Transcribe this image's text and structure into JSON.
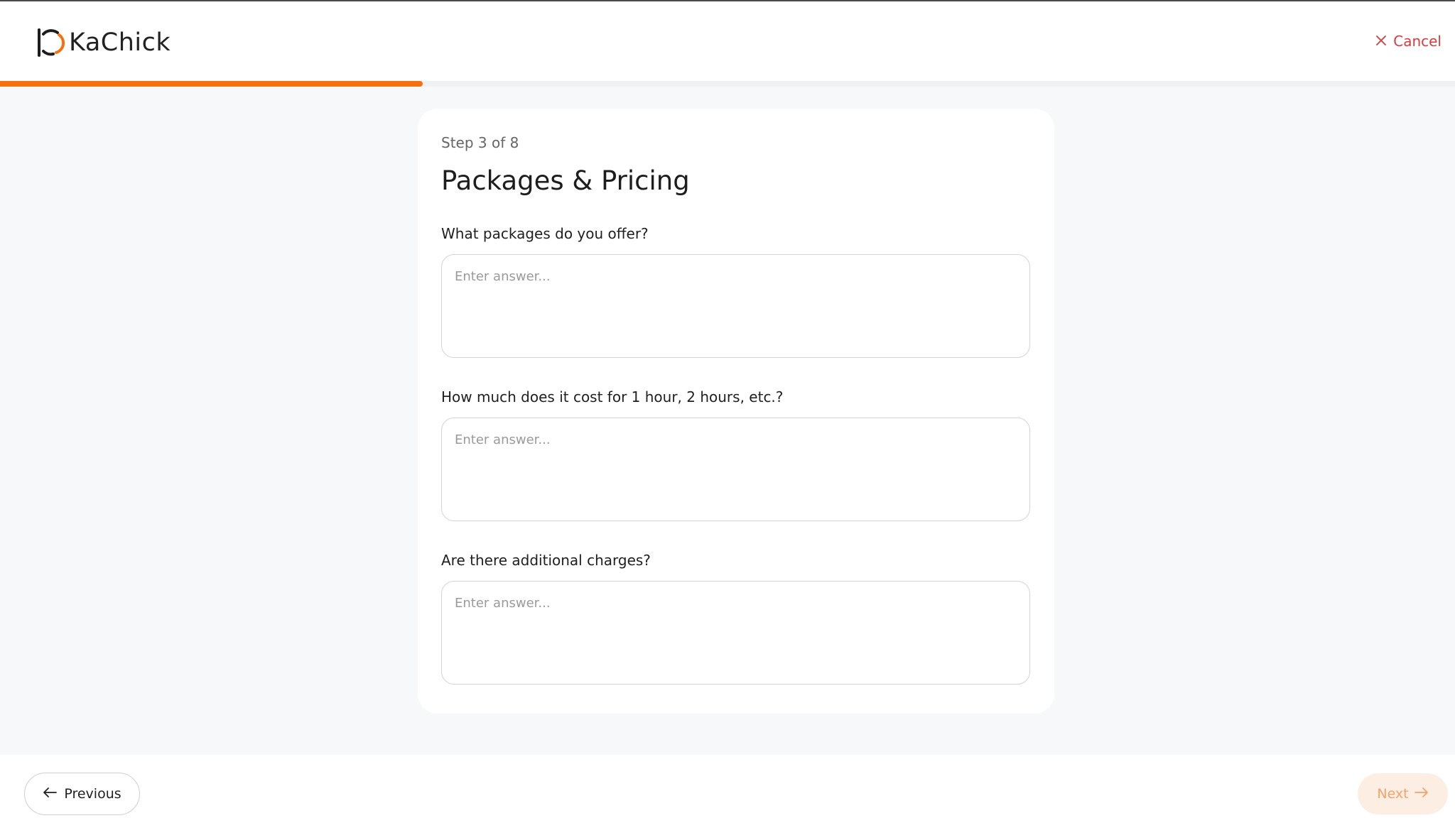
{
  "app": {
    "name": "KaChick"
  },
  "header": {
    "cancel_label": "Cancel"
  },
  "progress": {
    "current_step": 3,
    "total_steps": 8,
    "fraction": 0.375
  },
  "form": {
    "step_label": "Step 3 of 8",
    "title": "Packages & Pricing",
    "questions": [
      {
        "label": "What packages do you offer?",
        "placeholder": "Enter answer...",
        "value": ""
      },
      {
        "label": "How much does it cost for 1 hour, 2 hours, etc.?",
        "placeholder": "Enter answer...",
        "value": ""
      },
      {
        "label": "Are there additional charges?",
        "placeholder": "Enter answer...",
        "value": ""
      }
    ]
  },
  "footer": {
    "previous_label": "Previous",
    "next_label": "Next"
  },
  "colors": {
    "accent": "#f6700f",
    "cancel": "#d93b3b",
    "next_disabled_bg": "#fdeee4",
    "next_disabled_text": "#f4a36a"
  },
  "icons": {
    "logo": "kachick-logo-icon",
    "cancel": "close-icon",
    "previous": "arrow-left-icon",
    "next": "arrow-right-icon"
  }
}
